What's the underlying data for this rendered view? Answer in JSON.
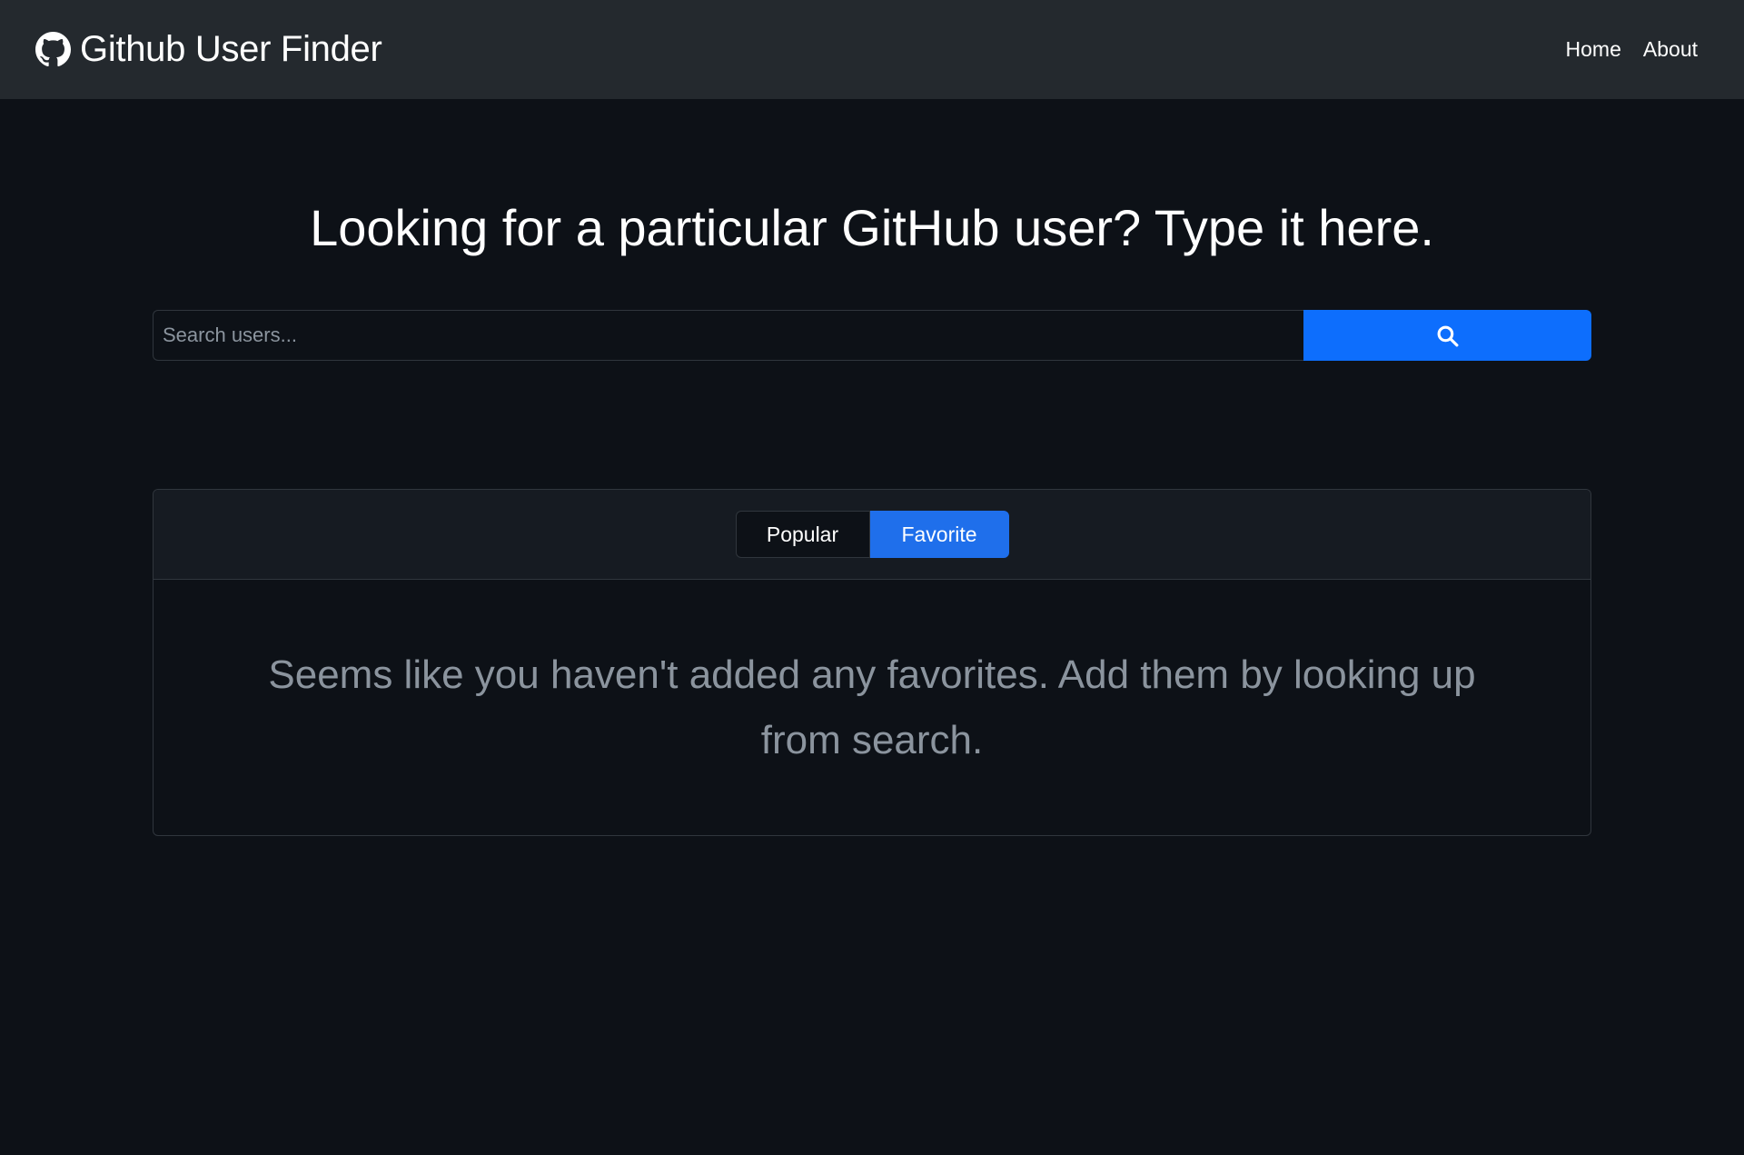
{
  "navbar": {
    "brand_icon": "github-logo-icon",
    "brand_title": "Github User Finder",
    "links": [
      {
        "label": "Home"
      },
      {
        "label": "About"
      }
    ]
  },
  "hero": {
    "title": "Looking for a particular GitHub user? Type it here."
  },
  "search": {
    "value": "",
    "placeholder": "Search users...",
    "button_icon": "search-icon",
    "button_color": "#0d6efd"
  },
  "tabs": {
    "items": [
      {
        "label": "Popular",
        "active": false
      },
      {
        "label": "Favorite",
        "active": true
      }
    ],
    "active_color": "#1f6feb"
  },
  "favorites": {
    "empty_message": "Seems like you haven't added any favorites. Add them by looking up from search."
  },
  "colors": {
    "background": "#0d1117",
    "navbar": "#24292e",
    "muted_text": "#8b949e"
  }
}
